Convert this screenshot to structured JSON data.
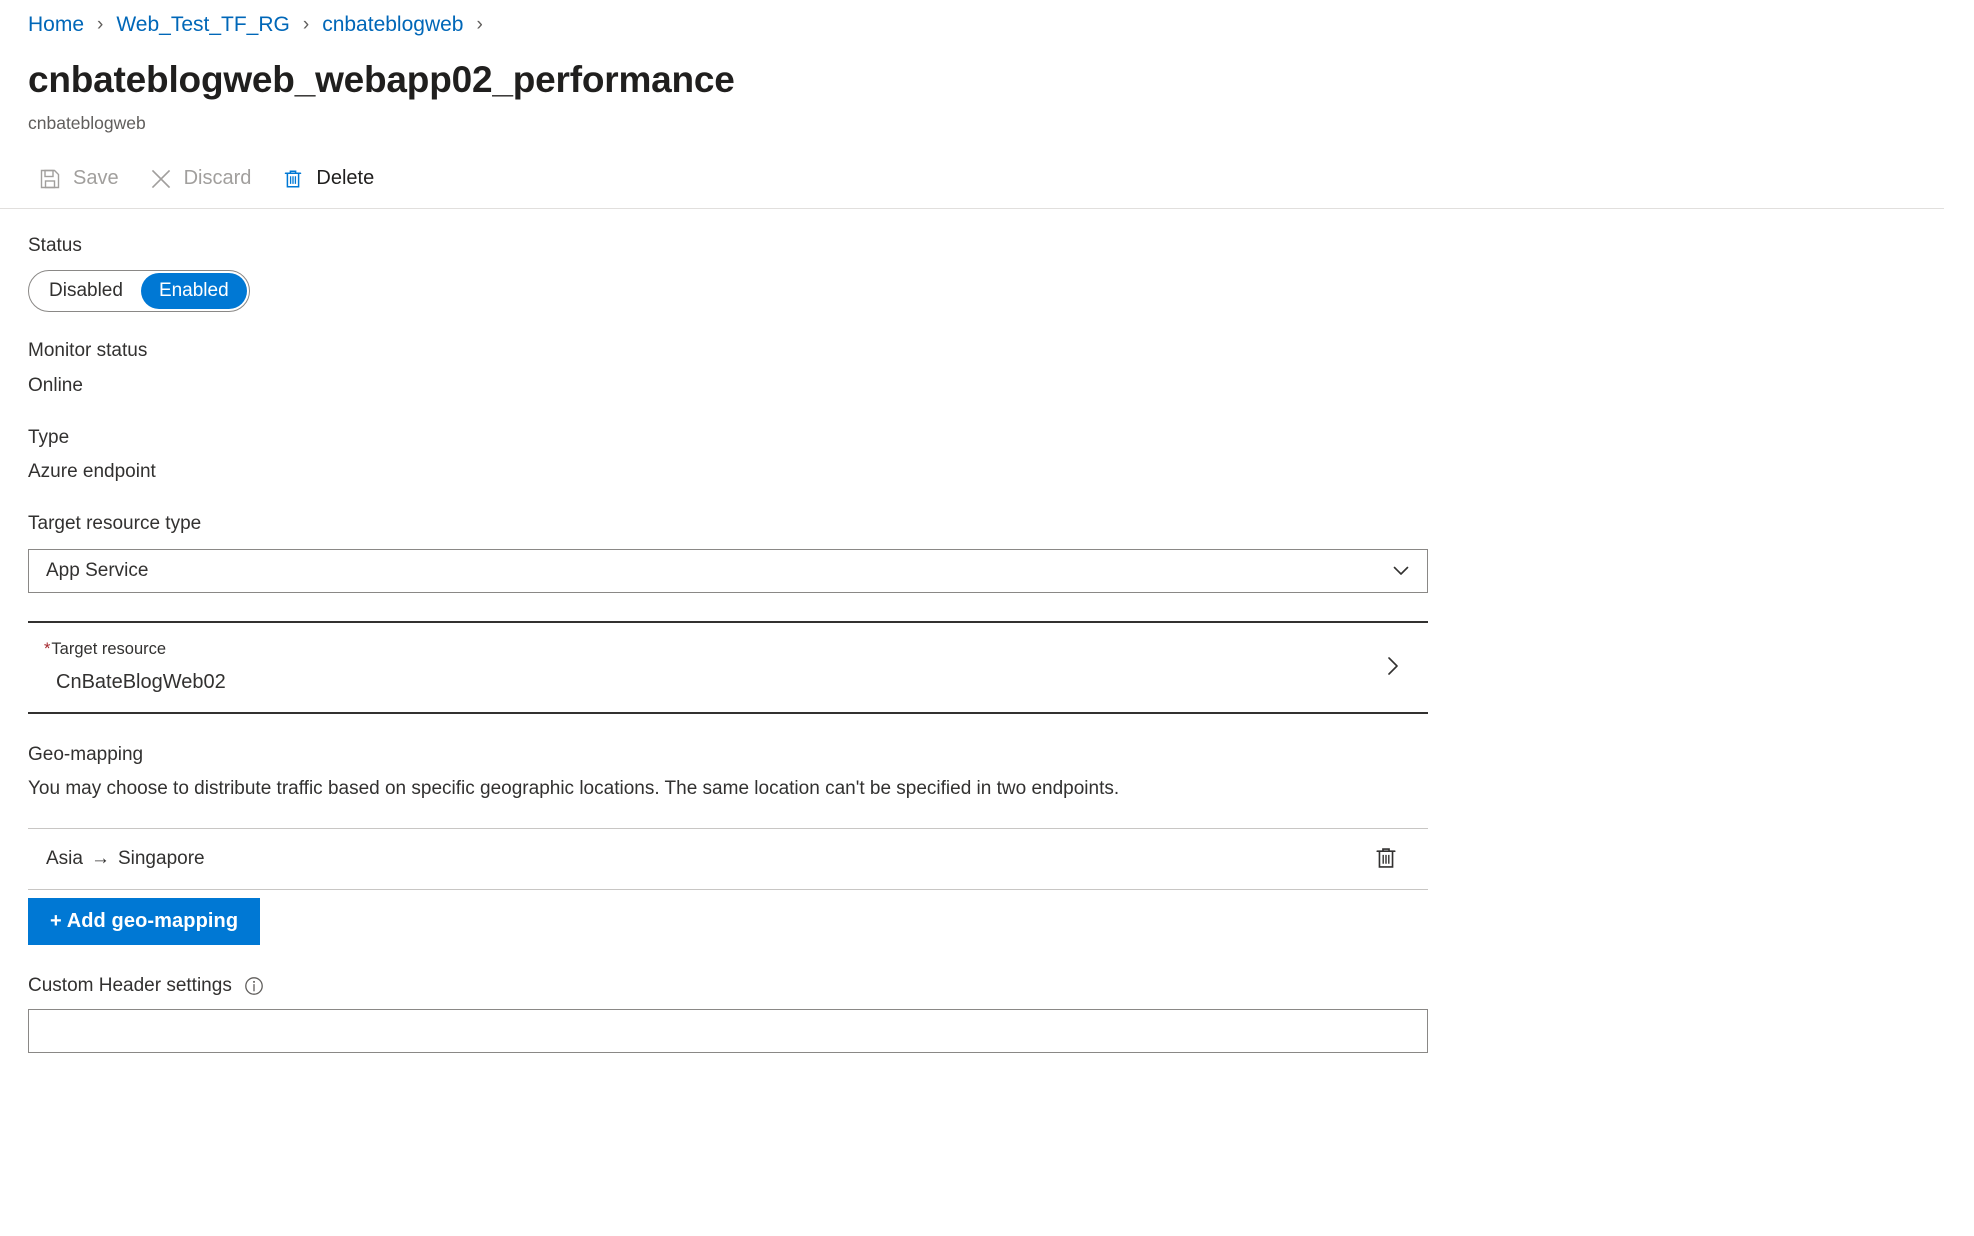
{
  "breadcrumb": {
    "separator": "›",
    "items": [
      {
        "label": "Home"
      },
      {
        "label": "Web_Test_TF_RG"
      },
      {
        "label": "cnbateblogweb"
      }
    ]
  },
  "header": {
    "title": "cnbateblogweb_webapp02_performance",
    "subtitle": "cnbateblogweb"
  },
  "toolbar": {
    "save_label": "Save",
    "discard_label": "Discard",
    "delete_label": "Delete",
    "save_icon": "save-floppy-icon",
    "discard_icon": "close-x-icon",
    "delete_icon": "trash-icon"
  },
  "form": {
    "status": {
      "label": "Status",
      "option_disabled": "Disabled",
      "option_enabled": "Enabled",
      "selected": "Enabled"
    },
    "monitor_status": {
      "label": "Monitor status",
      "value": "Online"
    },
    "type": {
      "label": "Type",
      "value": "Azure endpoint"
    },
    "target_resource_type": {
      "label": "Target resource type",
      "value": "App Service",
      "chevron_icon": "chevron-down-icon"
    },
    "target_resource": {
      "required_marker": "*",
      "label": "Target resource",
      "value": "CnBateBlogWeb02",
      "chevron_icon": "chevron-right-icon"
    },
    "geo_mapping": {
      "label": "Geo-mapping",
      "description": "You may choose to distribute traffic based on specific geographic locations. The same location can't be specified in two endpoints.",
      "rows": [
        {
          "region": "Asia",
          "arrow": "→",
          "location": "Singapore",
          "delete_icon": "trash-icon"
        }
      ],
      "add_button_label": "+ Add geo-mapping"
    },
    "custom_header": {
      "label": "Custom Header settings",
      "info_icon": "info-icon",
      "value": "",
      "placeholder": ""
    }
  },
  "colors": {
    "accent": "#0078d4",
    "link": "#0067b8",
    "required": "#a4262c",
    "text": "#323130",
    "disabled_text": "#a19f9d"
  }
}
